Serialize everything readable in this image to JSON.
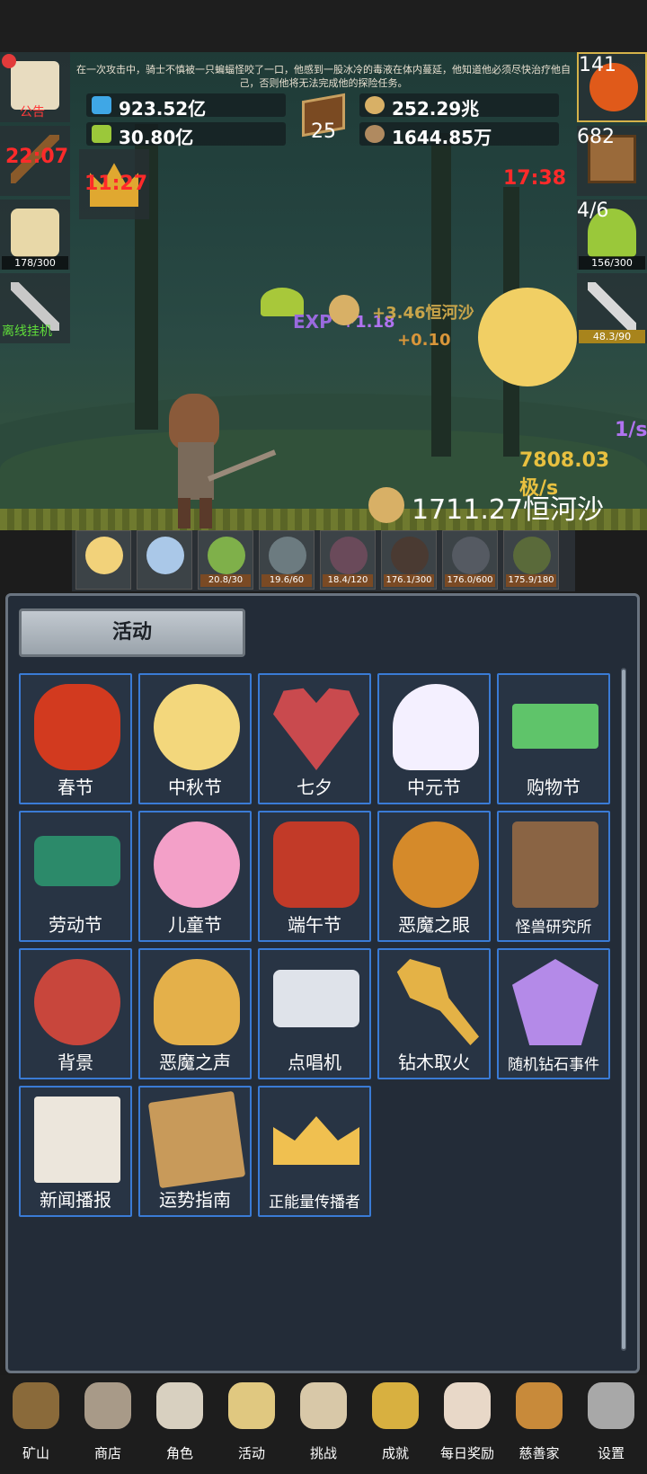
{
  "story": "在一次攻击中，骑士不慎被一只蝙蝠怪咬了一口，他感到一股冰冷的毒液在体内蔓延，他知道他必须尽快治疗他自己，否则他将无法完成他的探险任务。",
  "resources": {
    "blue_potion": "923.52亿",
    "green_potion": "30.80亿",
    "coin": "252.29兆",
    "stone": "1644.85万",
    "book_level": "25"
  },
  "left_slots": {
    "scroll_label": "公告",
    "torch_timer": "22:07",
    "beer_count": "178/300",
    "key_label": "离线挂机"
  },
  "crown_timer": "11:27",
  "right_slots": {
    "potion_count": "141",
    "chest_count": "682",
    "chest_timer": "17:38",
    "slime_ratio": "4/6",
    "slime_count": "156/300",
    "sword_count": "48.3/90"
  },
  "floats": {
    "exp": "EXP",
    "exp_gain": "+1.18",
    "coin_gain": "+3.46恒河沙",
    "sword_gain": "+0.10"
  },
  "rates": {
    "per_sec": "1/s",
    "rate": "7808.03极/s",
    "total": "1711.27恒河沙"
  },
  "monsters": [
    {
      "label": "",
      "color": "#f2d27a"
    },
    {
      "label": "",
      "color": "#aac8e8"
    },
    {
      "label": "20.8/30",
      "color": "#7fb04a"
    },
    {
      "label": "19.6/60",
      "color": "#6c7b80"
    },
    {
      "label": "18.4/120",
      "color": "#6a4a5a"
    },
    {
      "label": "176.1/300",
      "color": "#4a3a32"
    },
    {
      "label": "176.0/600",
      "color": "#555a62"
    },
    {
      "label": "175.9/180",
      "color": "#5a6a3a"
    }
  ],
  "panel": {
    "title": "活动",
    "items": [
      {
        "label": "春节",
        "icon": "lantern-icon",
        "color": "#d23a1f"
      },
      {
        "label": "中秋节",
        "icon": "moon-icon",
        "color": "#f3d77c"
      },
      {
        "label": "七夕",
        "icon": "heart-icon",
        "color": "#c94a4e"
      },
      {
        "label": "中元节",
        "icon": "ghost-icon",
        "color": "#f4f0ff"
      },
      {
        "label": "购物节",
        "icon": "money-icon",
        "color": "#5fc46a"
      },
      {
        "label": "劳动节",
        "icon": "brush-icon",
        "color": "#2c8a6a"
      },
      {
        "label": "儿童节",
        "icon": "lollipop-icon",
        "color": "#f3a0c8"
      },
      {
        "label": "端午节",
        "icon": "dragon-mask-icon",
        "color": "#c23a28"
      },
      {
        "label": "恶魔之眼",
        "icon": "demon-eye-icon",
        "color": "#d58a2a"
      },
      {
        "label": "怪兽研究所",
        "icon": "lab-crate-icon",
        "color": "#8a6444"
      },
      {
        "label": "背景",
        "icon": "sunset-icon",
        "color": "#c8463c"
      },
      {
        "label": "恶魔之声",
        "icon": "bell-icon",
        "color": "#e4b04a"
      },
      {
        "label": "点唱机",
        "icon": "cassette-icon",
        "color": "#dfe3ea"
      },
      {
        "label": "钻木取火",
        "icon": "torch-stick-icon",
        "color": "#e4b246"
      },
      {
        "label": "随机钻石事件",
        "icon": "diamond-icon",
        "color": "#b48ae8"
      },
      {
        "label": "新闻播报",
        "icon": "newspaper-icon",
        "color": "#ece6dc"
      },
      {
        "label": "运势指南",
        "icon": "fortune-book-icon",
        "color": "#c89a5a"
      },
      {
        "label": "正能量传播者",
        "icon": "golden-crown-icon",
        "color": "#f0c050"
      }
    ]
  },
  "nav": [
    {
      "label": "矿山",
      "icon": "lantern-nav-icon"
    },
    {
      "label": "商店",
      "icon": "stone-nav-icon"
    },
    {
      "label": "角色",
      "icon": "skull-nav-icon"
    },
    {
      "label": "活动",
      "icon": "scroll-nav-icon"
    },
    {
      "label": "挑战",
      "icon": "map-nav-icon"
    },
    {
      "label": "成就",
      "icon": "key-nav-icon"
    },
    {
      "label": "每日奖励",
      "icon": "letter-nav-icon"
    },
    {
      "label": "慈善家",
      "icon": "bread-nav-icon"
    },
    {
      "label": "设置",
      "icon": "gear-nav-icon"
    }
  ]
}
